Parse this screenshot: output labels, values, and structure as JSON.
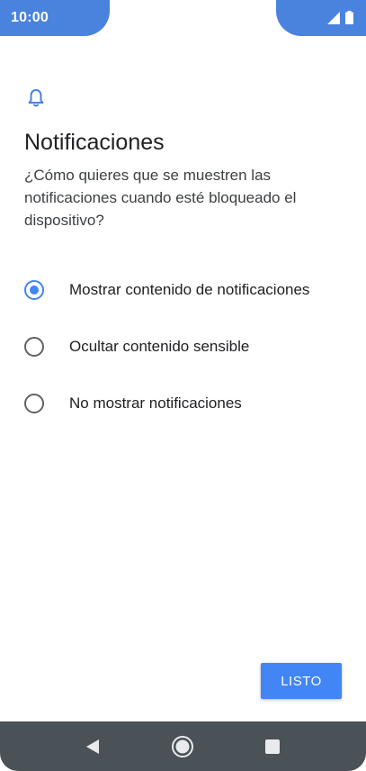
{
  "status_bar": {
    "time": "10:00",
    "icons": [
      "signal-icon",
      "battery-icon"
    ],
    "accent_color": "#4a83dd"
  },
  "screen": {
    "icon": "bell-icon",
    "title": "Notificaciones",
    "subtitle": "¿Cómo quieres que se muestren las notificaciones cuando esté bloqueado el dispositivo?"
  },
  "options": [
    {
      "label": "Mostrar contenido de notificaciones",
      "selected": true
    },
    {
      "label": "Ocultar contenido sensible",
      "selected": false
    },
    {
      "label": "No mostrar notificaciones",
      "selected": false
    }
  ],
  "done_button": {
    "label": "LISTO",
    "color": "#4285f4"
  },
  "nav_bar": {
    "buttons": [
      "back-icon",
      "home-icon",
      "recents-icon"
    ]
  }
}
